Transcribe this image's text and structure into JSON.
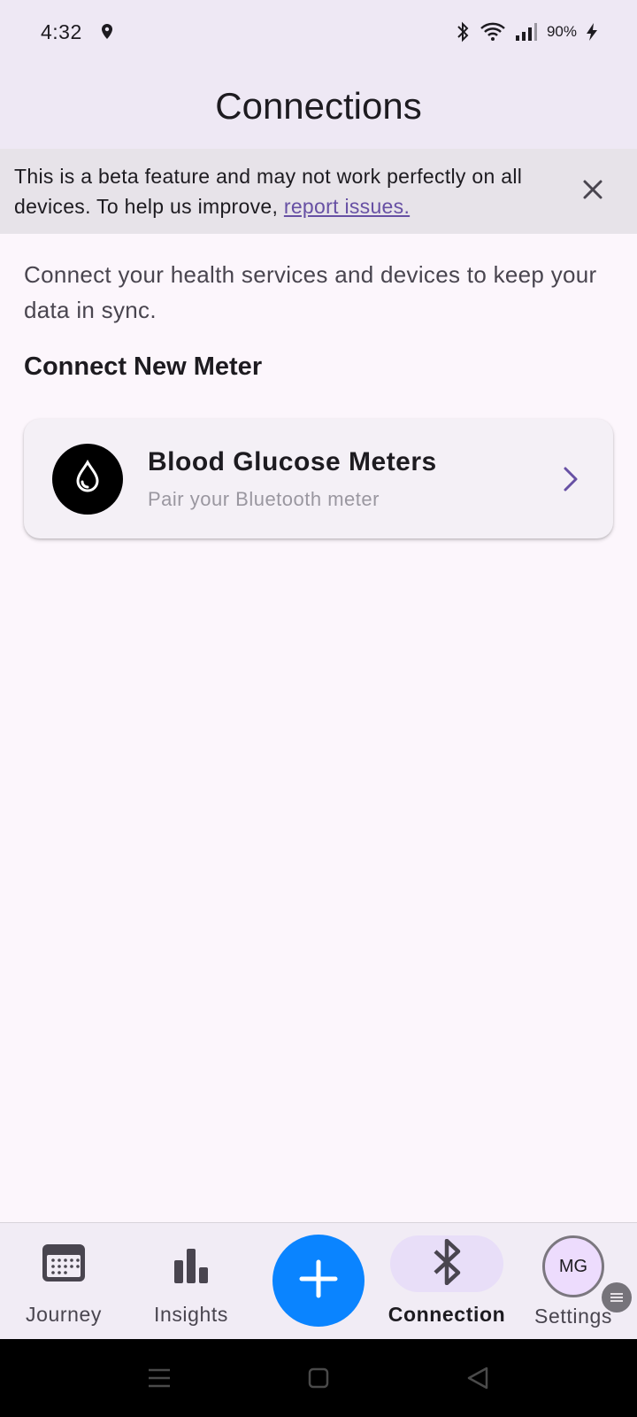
{
  "status_bar": {
    "time": "4:32",
    "battery": "90%",
    "icons": [
      "location-icon",
      "bluetooth-icon",
      "wifi-icon",
      "signal-icon",
      "charging-icon"
    ]
  },
  "app_bar": {
    "title": "Connections"
  },
  "banner": {
    "text": "This is a beta feature and may not work perfectly on all devices. To help us improve, ",
    "link": "report issues.",
    "link_color": "#6750a4"
  },
  "content": {
    "intro": "Connect your health services and devices to keep your data in sync.",
    "section_title": "Connect New Meter",
    "meter_card": {
      "title": "Blood Glucose Meters",
      "subtitle": "Pair your Bluetooth meter",
      "icon": "blood-drop-icon"
    }
  },
  "bottom_nav": {
    "items": [
      {
        "label": "Journey",
        "icon": "calendar-icon"
      },
      {
        "label": "Insights",
        "icon": "bar-chart-icon"
      },
      {
        "label": "Connection",
        "icon": "bluetooth-icon",
        "active": true
      },
      {
        "label": "Settings",
        "icon": "avatar"
      }
    ],
    "avatar_initials": "MG",
    "fab_icon": "plus-icon",
    "fab_color": "#0a84ff",
    "active_pill_color": "#e8def8"
  },
  "system_nav": {
    "buttons": [
      "menu-icon",
      "home-icon",
      "back-icon"
    ]
  }
}
